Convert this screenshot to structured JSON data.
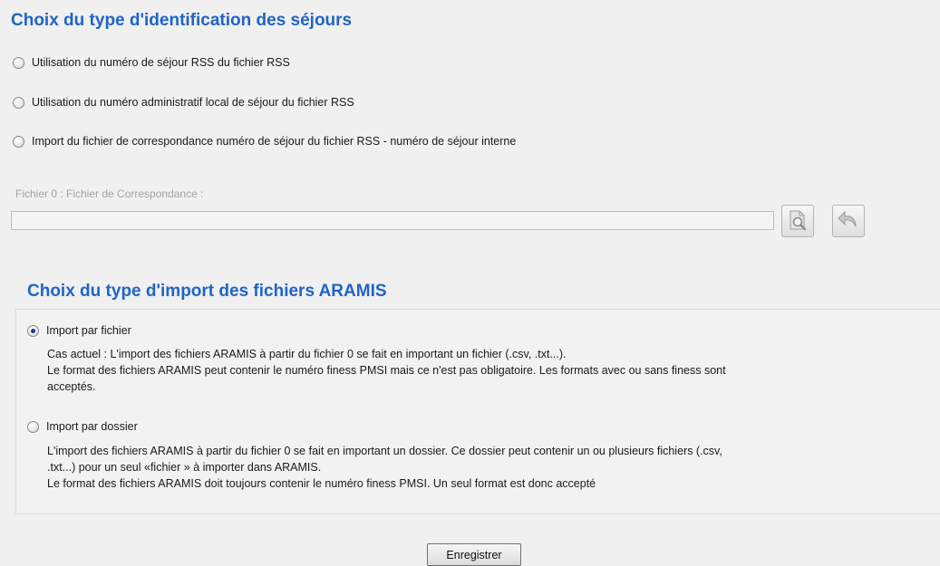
{
  "section1": {
    "title": "Choix du type d'identification des séjours",
    "options": [
      {
        "label": "Utilisation du numéro de séjour RSS du fichier RSS",
        "checked": false
      },
      {
        "label": "Utilisation du numéro administratif local de séjour du fichier RSS",
        "checked": false
      },
      {
        "label": "Import du fichier de correspondance numéro de séjour du fichier RSS  -  numéro de séjour interne",
        "checked": false
      }
    ],
    "file_label": "Fichier 0 : Fichier de Correspondance :",
    "file_value": "",
    "browse_icon": "search-file-icon",
    "undo_icon": "undo-icon"
  },
  "section2": {
    "title": "Choix du type d'import des fichiers ARAMIS",
    "options": [
      {
        "label": "Import par fichier",
        "checked": true,
        "desc": [
          "Cas actuel : L'import des fichiers ARAMIS à partir du fichier 0 se fait en important un fichier (.csv, .txt...).",
          "Le format des fichiers ARAMIS peut contenir le numéro finess PMSI mais ce n'est pas obligatoire. Les formats avec ou sans finess sont",
          "acceptés."
        ]
      },
      {
        "label": "Import par dossier",
        "checked": false,
        "desc": [
          "L'import des fichiers ARAMIS à partir du fichier 0 se fait en important un dossier. Ce dossier peut contenir un ou plusieurs fichiers (.csv,",
          ".txt...) pour un seul «fichier » à importer dans ARAMIS.",
          "Le format des fichiers ARAMIS doit toujours contenir le numéro finess PMSI. Un seul format est donc accepté"
        ]
      }
    ]
  },
  "save_label": "Enregistrer",
  "colors": {
    "title": "#1f64c8",
    "background": "#f0f0f0"
  }
}
